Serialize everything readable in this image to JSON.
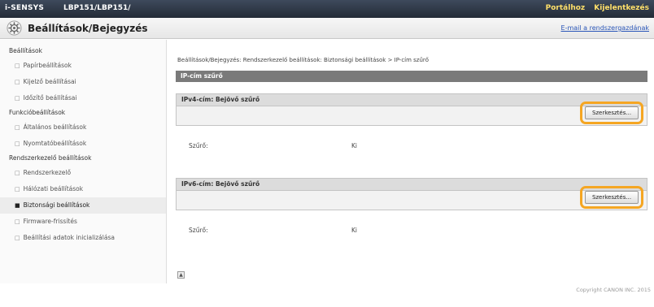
{
  "topbar": {
    "brand": "i-SENSYS",
    "model": "LBP151/LBP151/",
    "links": [
      "Portálhoz",
      "Kijelentkezés"
    ]
  },
  "header": {
    "title": "Beállítások/Bejegyzés",
    "mail_link": "E-mail a rendszergazdának"
  },
  "sidebar": {
    "sections": [
      {
        "label": "Beállítások",
        "items": [
          {
            "label": "Papírbeállítások",
            "active": false
          },
          {
            "label": "Kijelző beállításai",
            "active": false
          },
          {
            "label": "Időzítő beállításai",
            "active": false
          }
        ]
      },
      {
        "label": "Funkcióbeállítások",
        "items": [
          {
            "label": "Általános beállítások",
            "active": false
          },
          {
            "label": "Nyomtatóbeállítások",
            "active": false
          }
        ]
      },
      {
        "label": "Rendszerkezelő beállítások",
        "items": [
          {
            "label": "Rendszerkezelő",
            "active": false
          },
          {
            "label": "Hálózati beállítások",
            "active": false
          },
          {
            "label": "Biztonsági beállítások",
            "active": true
          },
          {
            "label": "Firmware-frissítés",
            "active": false
          },
          {
            "label": "Beállítási adatok inicializálása",
            "active": false
          }
        ]
      }
    ]
  },
  "main": {
    "breadcrumb": "Beállítások/Bejegyzés: Rendszerkezelő beállítások: Biztonsági beállítások > IP-cím szűrő",
    "title": "IP-cím szűrő",
    "sections": [
      {
        "heading": "IPv4-cím: Bejövő szűrő",
        "edit_label": "Szerkesztés...",
        "row_label": "Szűrő:",
        "row_value": "Ki"
      },
      {
        "heading": "IPv6-cím: Bejövő szűrő",
        "edit_label": "Szerkesztés...",
        "row_label": "Szűrő:",
        "row_value": "Ki"
      }
    ]
  },
  "footer": {
    "copyright": "Copyright CANON INC. 2015"
  },
  "colors": {
    "topbar": "#2c3542",
    "link_yellow": "#ffe06a",
    "highlight": "#f5a623",
    "title_bar": "#7a7a7a"
  }
}
